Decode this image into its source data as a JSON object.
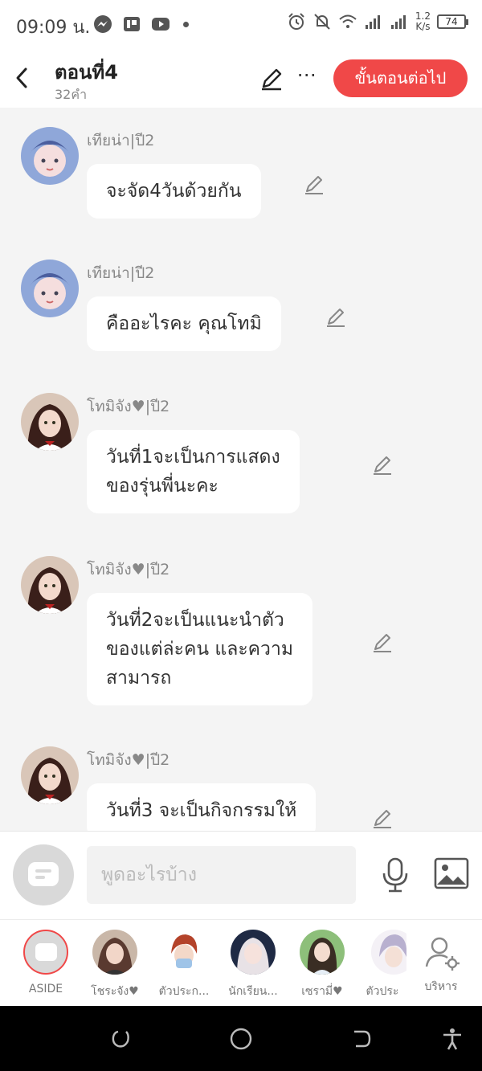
{
  "status_bar": {
    "time": "09:09 น.",
    "speed_value": "1.2",
    "speed_unit": "K/s",
    "battery": "74"
  },
  "header": {
    "title": "ตอนที่4",
    "subtitle": "32คำ",
    "next_label": "ขั้นตอนต่อไป"
  },
  "messages": [
    {
      "sender": "เทียน่า|ปี2",
      "lines": [
        "จะจัด4วันด้วยกัน"
      ]
    },
    {
      "sender": "เทียน่า|ปี2",
      "lines": [
        "คืออะไรคะ คุณโทมิ"
      ]
    },
    {
      "sender": "โทมิจัง♥|ปี2",
      "lines": [
        "วันที่1จะเป็นการแสดง",
        "ของรุ่นพี่นะคะ"
      ]
    },
    {
      "sender": "โทมิจัง♥|ปี2",
      "lines": [
        "วันที่2จะเป็นแนะนำตัว",
        "ของแต่ล่ะคน และความ",
        "สามารถ"
      ]
    },
    {
      "sender": "โทมิจัง♥|ปี2",
      "lines": [
        "วันที่3 จะเป็นกิจกรรมให้"
      ]
    }
  ],
  "composer": {
    "placeholder": "พูดอะไรบ้าง"
  },
  "characters": [
    {
      "label": "ASIDE"
    },
    {
      "label": "โชระจัง♥"
    },
    {
      "label": "ตัวประก..."
    },
    {
      "label": "นักเรียน..."
    },
    {
      "label": "เซรามี่♥"
    },
    {
      "label": "ตัวประ"
    },
    {
      "label": "บริหาร"
    }
  ],
  "colors": {
    "accent": "#f04848",
    "chat_bg": "#f4f4f4",
    "bubble": "#ffffff",
    "meta_text": "#888888"
  }
}
